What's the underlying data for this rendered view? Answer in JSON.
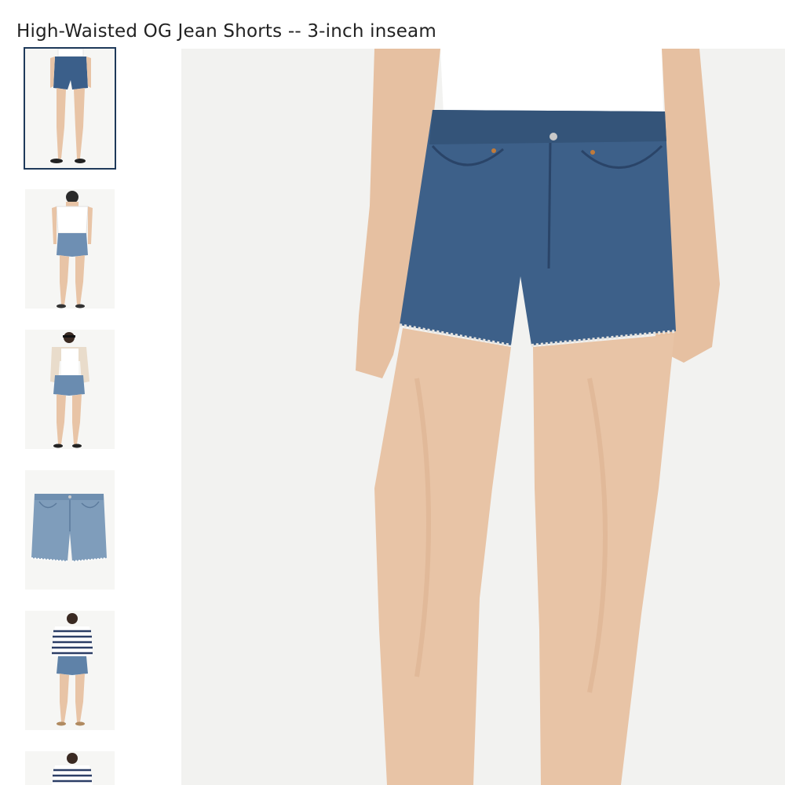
{
  "product": {
    "title": "High-Waisted OG Jean Shorts -- 3-inch inseam"
  },
  "colors": {
    "denim_dark": "#3b5f8a",
    "denim_light": "#7f9dbb",
    "skin": "#e8c4a6",
    "shirt": "#ffffff",
    "background": "#f2f2f0",
    "selected_border": "#1f3a5a"
  },
  "gallery": {
    "selected_index": 0,
    "thumbnails": [
      {
        "icon": "front-view-model"
      },
      {
        "icon": "back-view-model"
      },
      {
        "icon": "model-with-cardigan"
      },
      {
        "icon": "flat-lay-shorts"
      },
      {
        "icon": "model-striped-sweater"
      },
      {
        "icon": "model-striped-top-partial"
      }
    ]
  }
}
